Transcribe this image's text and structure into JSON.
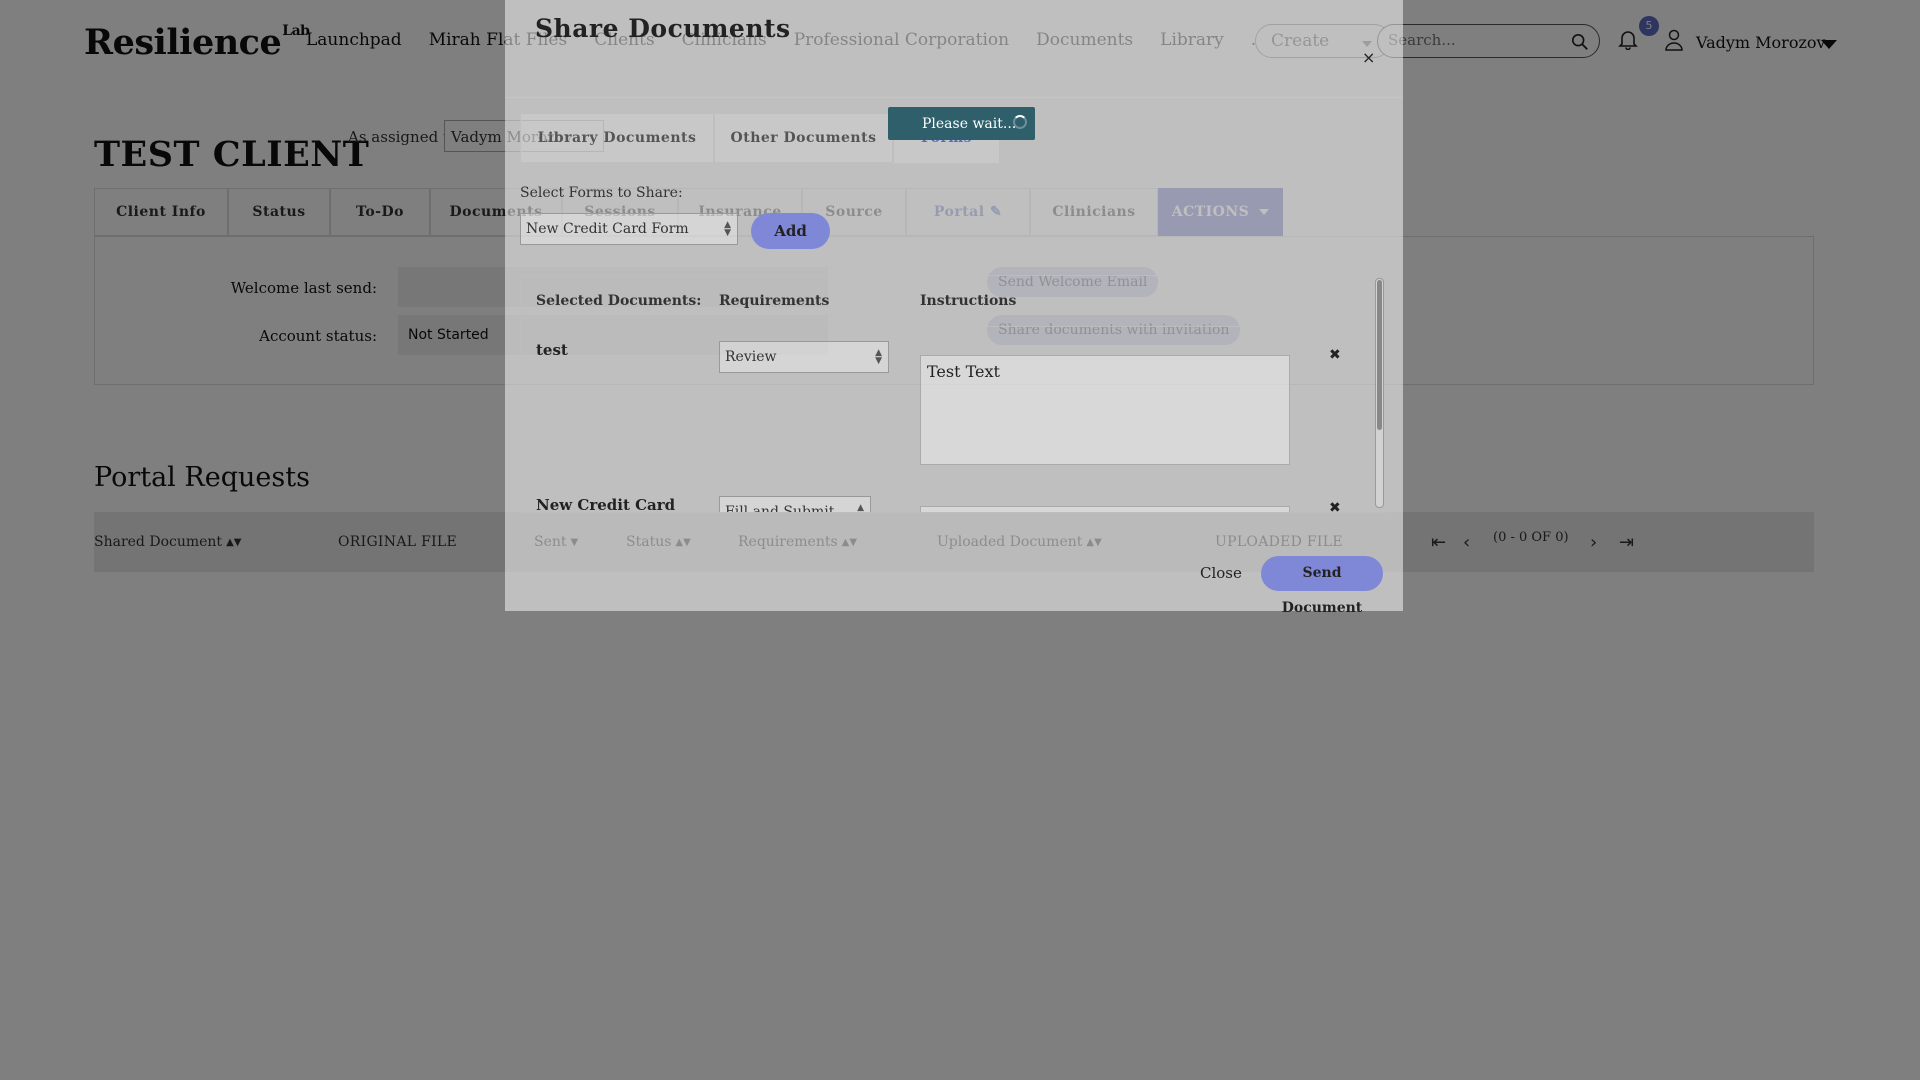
{
  "header": {
    "logo": "Resilience",
    "logo_sup": "Lab",
    "nav": [
      "Launchpad",
      "Mirah Flat Files",
      "Clients",
      "Clinicians",
      "Professional Corporation",
      "Documents",
      "Library",
      "..."
    ],
    "create_label": "Create",
    "search_placeholder": "Search...",
    "notification_count": "5",
    "user_name": "Vadym Morozov"
  },
  "client": {
    "title": "TEST CLIENT",
    "assigned_label": "As assigned to:",
    "assigned_value": "Vadym Morozov"
  },
  "tabs": [
    "Client Info",
    "Status",
    "To-Do",
    "Documents",
    "Sessions",
    "Insurance",
    "Source",
    "Portal",
    "Clinicians",
    "ACTIONS"
  ],
  "info": {
    "welcome_label": "Welcome last send:",
    "welcome_value": "",
    "account_label": "Account status:",
    "account_value": "Not Started",
    "send_welcome_label": "Send Welcome Email",
    "share_invitation_label": "Share documents with invitation"
  },
  "portal_requests": {
    "title": "Portal Requests",
    "columns": [
      "Shared Document",
      "ORIGINAL FILE",
      "Sent",
      "Status",
      "Requirements",
      "Uploaded Document",
      "UPLOADED FILE"
    ],
    "pager_text": "(0 - 0 OF 0)"
  },
  "modal": {
    "title": "Share Documents",
    "close_x": "×",
    "tabs": [
      "Library Documents",
      "Other Documents",
      "Forms"
    ],
    "active_tab": "Forms",
    "please_wait": "Please wait...",
    "select_label": "Select Forms to Share:",
    "selected_form": "New Credit Card Form",
    "add_label": "Add",
    "table_headers": [
      "Selected Documents:",
      "Requirements",
      "Instructions"
    ],
    "rows": [
      {
        "name": "test",
        "requirement": "Review",
        "instructions": "Test Text"
      },
      {
        "name": "New Credit Card",
        "requirement": "Fill and Submit",
        "instructions": ""
      }
    ],
    "close_label": "Close",
    "send_label": "Send Document"
  },
  "colors": {
    "accent": "#5c6bc0",
    "please_wait_bg": "#2e5f6b",
    "overlay": "rgba(0,0,0,0.5)"
  }
}
